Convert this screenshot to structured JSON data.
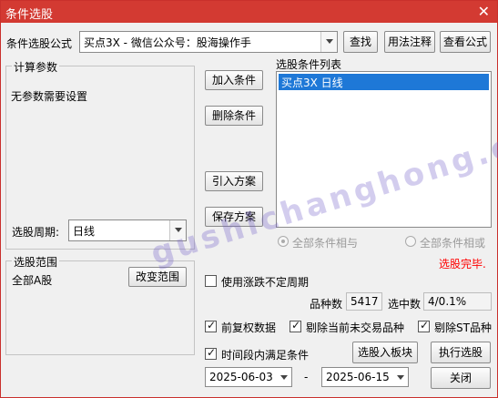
{
  "window": {
    "title": "条件选股",
    "close_icon": "close-icon"
  },
  "formula": {
    "label": "条件选股公式",
    "value": "买点3X  -  微信公众号：股海操作手",
    "find_button": "查找",
    "syntax_button": "用法注释",
    "view_button": "查看公式"
  },
  "params": {
    "group_title": "计算参数",
    "text": "无参数需要设置"
  },
  "actions": {
    "add": "加入条件",
    "remove": "删除条件",
    "import": "引入方案",
    "save": "保存方案"
  },
  "condition_list": {
    "title": "选股条件列表",
    "items": [
      "买点3X  日线"
    ]
  },
  "logic": {
    "and_label": "全部条件相与",
    "or_label": "全部条件相或"
  },
  "status": {
    "text": "选股完毕.",
    "color": "#ff0000"
  },
  "period": {
    "label": "选股周期:",
    "value": "日线"
  },
  "range": {
    "group_title": "选股范围",
    "value": "全部A股",
    "change_button": "改变范围"
  },
  "options": {
    "use_irregular_period": "使用涨跌不定周期",
    "count_label": "品种数",
    "count_value": "5417",
    "selected_label": "选中数",
    "selected_value": "4/0.1%",
    "pre_adjust": "前复权数据",
    "exclude_untraded": "剔除当前未交易品种",
    "exclude_st": "剔除ST品种",
    "time_range": "时间段内满足条件"
  },
  "buttons": {
    "to_block": "选股入板块",
    "execute": "执行选股",
    "close": "关闭"
  },
  "dates": {
    "start": "2025-06-03",
    "separator": "-",
    "end": "2025-06-15"
  },
  "watermark": "gushichanghong.com",
  "colors": {
    "title_bar": "#d33a32",
    "selection": "#1e78d7",
    "status": "#ff0000"
  }
}
